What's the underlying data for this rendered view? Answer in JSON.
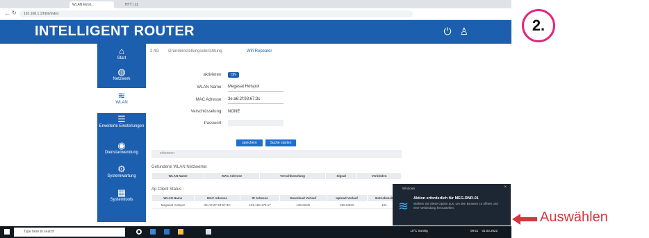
{
  "browser": {
    "tabs": [
      "WLAN Einst...",
      "HTT | 11 "
    ],
    "url": "192.168.1.1/html/index"
  },
  "header": {
    "title": "INTELLIGENT ROUTER",
    "power_icon": "power-icon",
    "user_icon": "user-icon"
  },
  "sidebar": {
    "items": [
      {
        "label": "Start",
        "icon": "home-icon"
      },
      {
        "label": "Netzwerk",
        "icon": "globe-icon"
      },
      {
        "label": "WLAN",
        "icon": "wifi-icon",
        "active": true
      },
      {
        "label": "Erweiterte Einstellungen",
        "icon": "sliders-icon"
      },
      {
        "label": "Dienstanwendung",
        "icon": "service-icon"
      },
      {
        "label": "Systemwartung",
        "icon": "gear-icon"
      },
      {
        "label": "Systemtools",
        "icon": "tools-icon"
      }
    ]
  },
  "main": {
    "tabs": [
      "2.4G",
      "Grundeinstellungseinrichtung",
      "Wifi Repeater"
    ],
    "form": {
      "enable_label": "aktivieren:",
      "enable_value": "ON",
      "ssid_label": "WLAN Name:",
      "ssid_value": "Megasat Hotspot",
      "mac_label": "MAC Adresse:",
      "mac_value": "3e:a6:2f:93:67:3c",
      "enc_label": "Verschlüsselung:",
      "enc_value": "NONE",
      "pw_label": "Passwort:"
    },
    "buttons": {
      "save": "speichern",
      "scan": "Suche starten"
    },
    "scan_status": "erkennen",
    "found_title": "Gefundene WLAN Netzwerke:",
    "found_headers": [
      "WLAN Name",
      "MAC Adresse",
      "Verschlüsselung",
      "Signal",
      "Verbinden"
    ],
    "client_title": "Ap Client Status :",
    "client_headers": [
      "WLAN Name",
      "MAC Adresse",
      "IP Adresse",
      "Download Verlauf",
      "Upload Verlauf",
      "Betriebszeit"
    ],
    "client_row": [
      "Megasat Hotspot",
      "3E:A6:2F:93:67:3C",
      "192.168.179.17",
      "135.02KB",
      "208.63KB",
      "10s"
    ]
  },
  "notification": {
    "app": "Windows",
    "title": "Aktion erforderlich für MEG-RNR-01",
    "message": "Wählen Sie diese Option aus, um den Browser zu öffnen und eine Verbindung herzustellen."
  },
  "taskbar": {
    "search_placeholder": "Type here to search",
    "weather": "10°C Sonnig",
    "time": "09:51",
    "date": "01.03.2022"
  },
  "annotation": {
    "step": "2.",
    "label": "Auswählen"
  }
}
